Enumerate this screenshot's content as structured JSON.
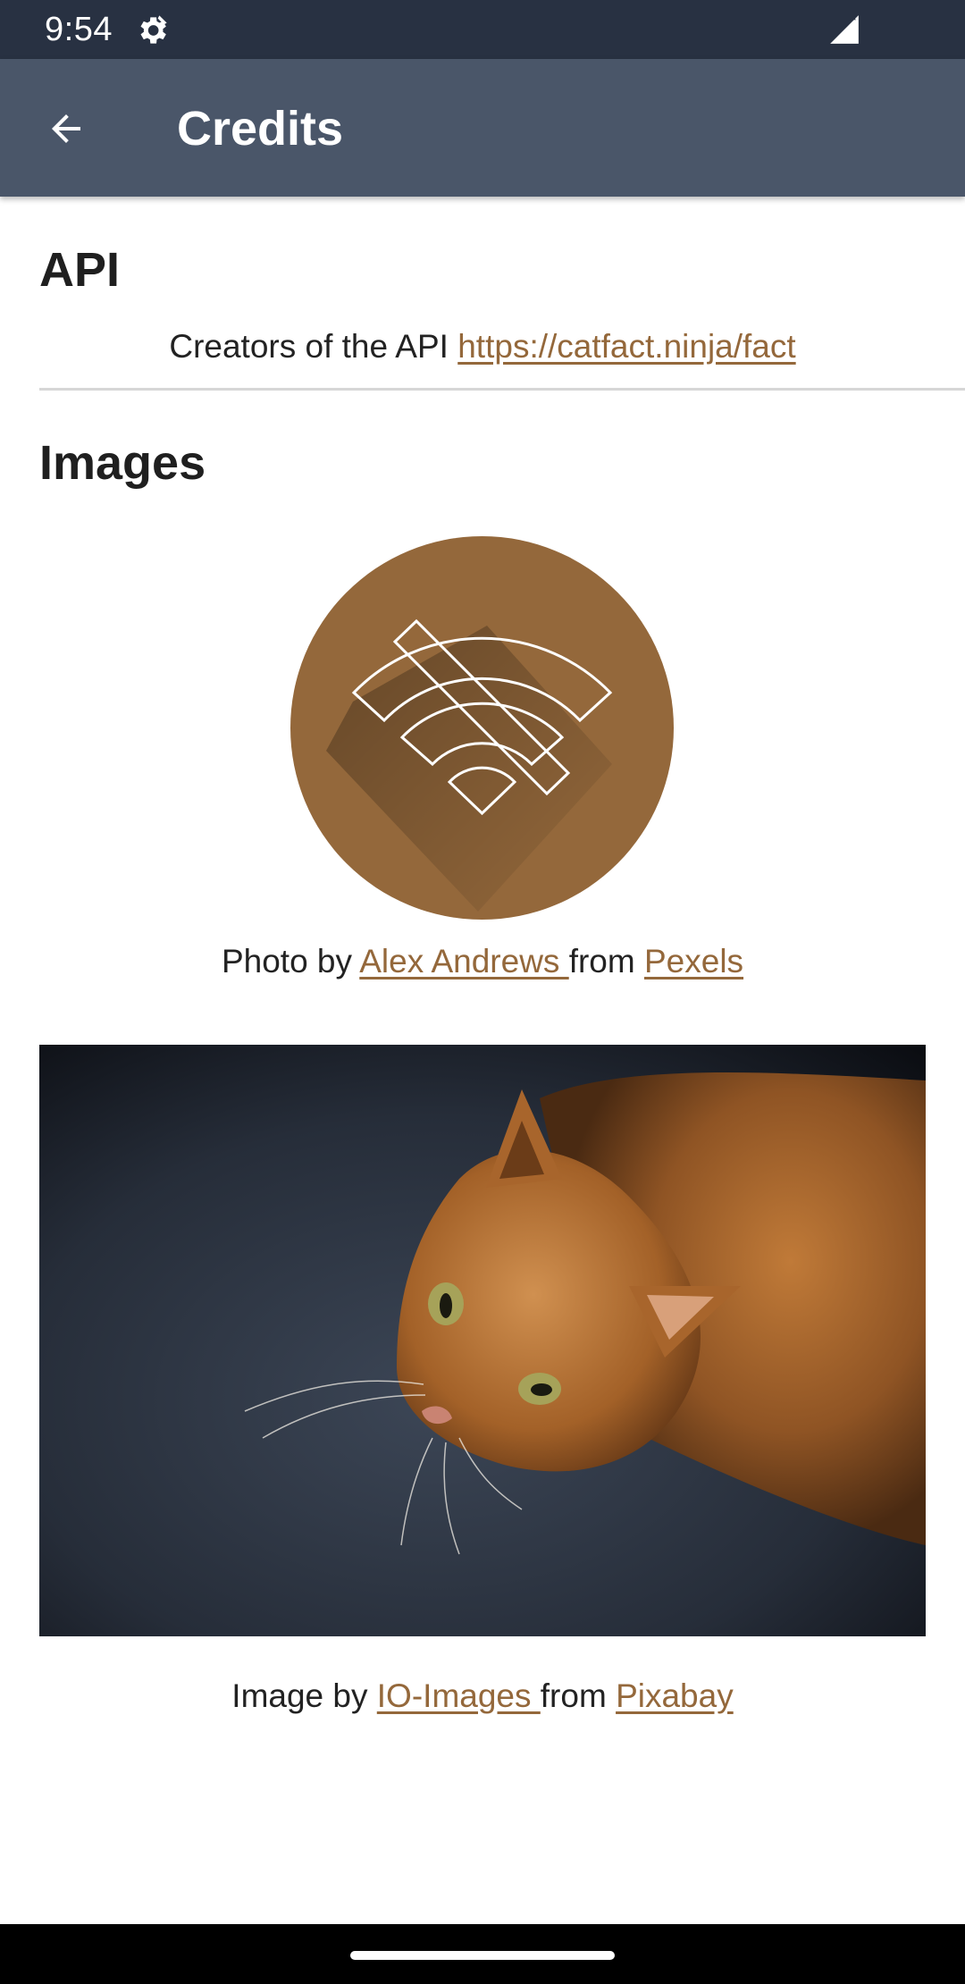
{
  "status_bar": {
    "time": "9:54",
    "icons": [
      "settings-icon",
      "signal-icon"
    ]
  },
  "app_bar": {
    "title": "Credits",
    "back_icon": "arrow-back-icon"
  },
  "api_section": {
    "heading": "API",
    "text": "Creators of the API ",
    "link": "https://catfact.ninja/fact"
  },
  "images_section": {
    "heading": "Images",
    "logo_credit": {
      "prefix": "Photo by ",
      "author": " Alex Andrews ",
      "middle": " from ",
      "source": " Pexels "
    },
    "photo_credit": {
      "prefix": "Image by ",
      "author": " IO-Images ",
      "middle": " from ",
      "source": " Pixabay "
    }
  },
  "colors": {
    "status_bar": "#283142",
    "app_bar": "#4a5669",
    "link": "#94683b",
    "logo_background": "#94683b"
  }
}
